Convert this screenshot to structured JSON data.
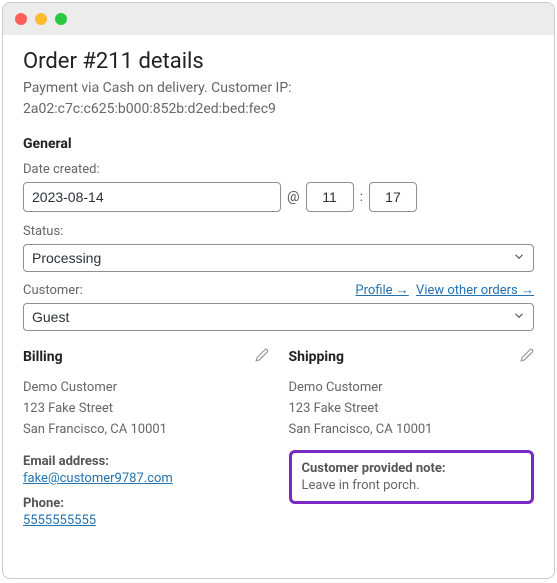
{
  "page_title": "Order #211 details",
  "subtitle_line1": "Payment via Cash on delivery. Customer IP:",
  "subtitle_line2": "2a02:c7c:c625:b000:852b:d2ed:bed:fec9",
  "general": {
    "header": "General",
    "date_label": "Date created:",
    "date_value": "2023-08-14",
    "at_symbol": "@",
    "hour_value": "11",
    "colon": ":",
    "minute_value": "17",
    "status_label": "Status:",
    "status_value": "Processing",
    "customer_label": "Customer:",
    "profile_link": "Profile →",
    "other_orders_link": "View other orders →",
    "customer_value": "Guest"
  },
  "billing": {
    "header": "Billing",
    "name": "Demo Customer",
    "street": "123 Fake Street",
    "city": "San Francisco, CA 10001",
    "email_label": "Email address:",
    "email_value": "fake@customer9787.com",
    "phone_label": "Phone:",
    "phone_value": "5555555555"
  },
  "shipping": {
    "header": "Shipping",
    "name": "Demo Customer",
    "street": "123 Fake Street",
    "city": "San Francisco, CA 10001",
    "note_label": "Customer provided note:",
    "note_value": "Leave in front porch."
  }
}
